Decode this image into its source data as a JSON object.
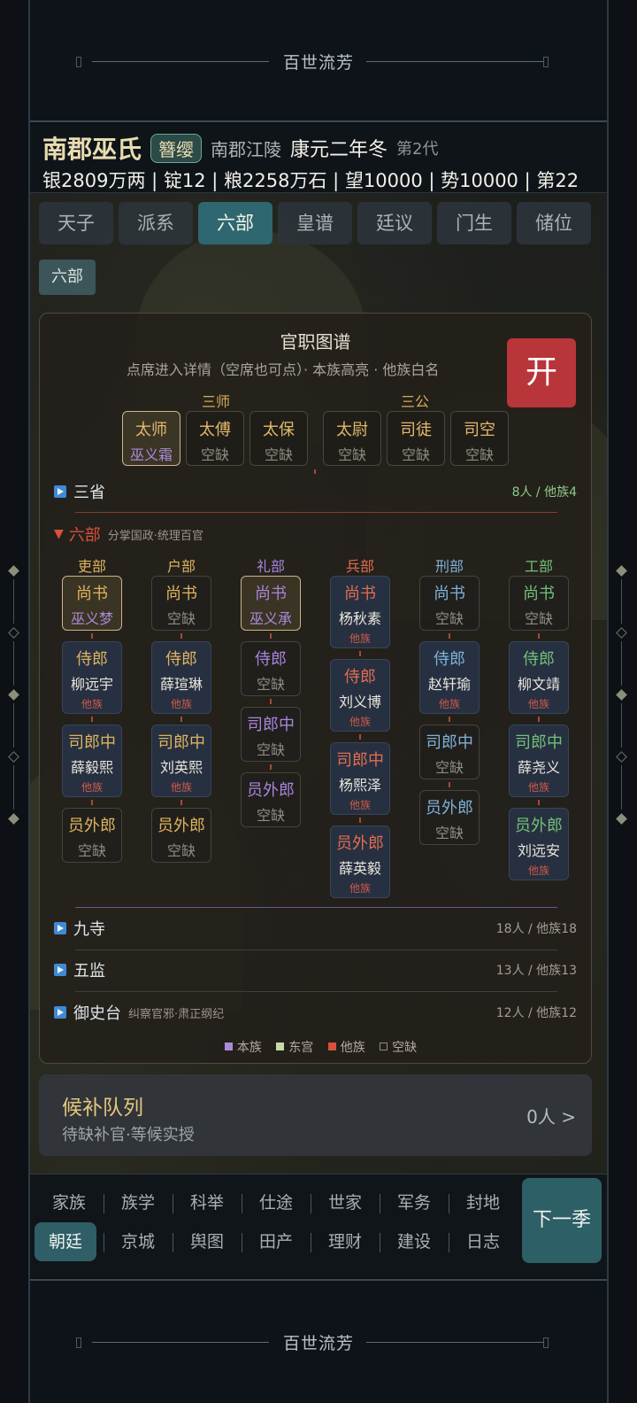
{
  "banner": {
    "title": "百世流芳"
  },
  "header": {
    "clan_name": "南郡巫氏",
    "badge": "簪缨",
    "place": "南郡江陵",
    "era": "康元二年冬",
    "generation": "第2代",
    "resources": "银2809万两 | 锭12 | 粮2258万石 | 望10000 | 势10000 | 第22"
  },
  "tabs": [
    "天子",
    "派系",
    "六部",
    "皇谱",
    "廷议",
    "门生",
    "储位"
  ],
  "sub_tab": "六部",
  "panel": {
    "title": "官职图谱",
    "subtitle": "点席进入详情（空席也可点）· 本族高亮 · 他族白名",
    "open_button": "开",
    "sanshi_label": "三师",
    "sangong_label": "三公",
    "sanshi": [
      {
        "title": "太师",
        "holder": "巫义霜"
      },
      {
        "title": "太傅",
        "holder": "空缺"
      },
      {
        "title": "太保",
        "holder": "空缺"
      }
    ],
    "sangong": [
      {
        "title": "太尉",
        "holder": "空缺"
      },
      {
        "title": "司徒",
        "holder": "空缺"
      },
      {
        "title": "司空",
        "holder": "空缺"
      }
    ],
    "sansheng": {
      "name": "三省",
      "stat": "8人 / 他族4"
    },
    "liubu": {
      "name": "六部",
      "note": "分掌国政·统理百官"
    },
    "depts": [
      {
        "name": "吏部",
        "color": "#e0b35e",
        "offices": [
          {
            "t": "尚书",
            "n": "巫义梦",
            "tag": "",
            "kind": "own"
          },
          {
            "t": "侍郎",
            "n": "柳远宇",
            "tag": "他族",
            "kind": "other"
          },
          {
            "t": "司郎中",
            "n": "薛毅熙",
            "tag": "他族",
            "kind": "other"
          },
          {
            "t": "员外郎",
            "n": "空缺",
            "tag": "",
            "kind": "empty"
          }
        ]
      },
      {
        "name": "户部",
        "color": "#e0b35e",
        "offices": [
          {
            "t": "尚书",
            "n": "空缺",
            "tag": "",
            "kind": "empty"
          },
          {
            "t": "侍郎",
            "n": "薛瑄琳",
            "tag": "他族",
            "kind": "other"
          },
          {
            "t": "司郎中",
            "n": "刘英熙",
            "tag": "他族",
            "kind": "other"
          },
          {
            "t": "员外郎",
            "n": "空缺",
            "tag": "",
            "kind": "empty"
          }
        ]
      },
      {
        "name": "礼部",
        "color": "#a985dc",
        "offices": [
          {
            "t": "尚书",
            "n": "巫义承",
            "tag": "",
            "kind": "own"
          },
          {
            "t": "侍郎",
            "n": "空缺",
            "tag": "",
            "kind": "empty"
          },
          {
            "t": "司郎中",
            "n": "空缺",
            "tag": "",
            "kind": "empty"
          },
          {
            "t": "员外郎",
            "n": "空缺",
            "tag": "",
            "kind": "empty"
          }
        ]
      },
      {
        "name": "兵部",
        "color": "#e16d50",
        "offices": [
          {
            "t": "尚书",
            "n": "杨秋素",
            "tag": "他族",
            "kind": "other"
          },
          {
            "t": "侍郎",
            "n": "刘义博",
            "tag": "他族",
            "kind": "other"
          },
          {
            "t": "司郎中",
            "n": "杨熙泽",
            "tag": "他族",
            "kind": "other"
          },
          {
            "t": "员外郎",
            "n": "薛英毅",
            "tag": "他族",
            "kind": "other"
          }
        ]
      },
      {
        "name": "刑部",
        "color": "#7fb1d9",
        "offices": [
          {
            "t": "尚书",
            "n": "空缺",
            "tag": "",
            "kind": "empty"
          },
          {
            "t": "侍郎",
            "n": "赵轩瑜",
            "tag": "他族",
            "kind": "other"
          },
          {
            "t": "司郎中",
            "n": "空缺",
            "tag": "",
            "kind": "empty"
          },
          {
            "t": "员外郎",
            "n": "空缺",
            "tag": "",
            "kind": "empty"
          }
        ]
      },
      {
        "name": "工部",
        "color": "#73c07a",
        "offices": [
          {
            "t": "尚书",
            "n": "空缺",
            "tag": "",
            "kind": "empty"
          },
          {
            "t": "侍郎",
            "n": "柳文靖",
            "tag": "他族",
            "kind": "other"
          },
          {
            "t": "司郎中",
            "n": "薛尧义",
            "tag": "他族",
            "kind": "other"
          },
          {
            "t": "员外郎",
            "n": "刘远安",
            "tag": "他族",
            "kind": "other"
          }
        ]
      }
    ],
    "jiusi": {
      "name": "九寺",
      "stat": "18人 / 他族18"
    },
    "wujian": {
      "name": "五监",
      "stat": "13人 / 他族13"
    },
    "yushitai": {
      "name": "御史台",
      "note": "纠察官邪·肃正纲纪",
      "stat": "12人 / 他族12"
    },
    "legend": [
      {
        "label": "本族",
        "color": "#a98bd8"
      },
      {
        "label": "东宫",
        "color": "#c8d8a8"
      },
      {
        "label": "他族",
        "color": "#d9503f"
      },
      {
        "label": "空缺",
        "color": "transparent"
      }
    ]
  },
  "queue": {
    "title": "候补队列",
    "subtitle": "待缺补官·等候实授",
    "count": "0人 >"
  },
  "nav": {
    "row1": [
      "家族",
      "族学",
      "科举",
      "仕途",
      "世家",
      "军务",
      "封地"
    ],
    "row2": [
      "朝廷",
      "京城",
      "舆图",
      "田产",
      "理财",
      "建设",
      "日志"
    ],
    "active": "朝廷",
    "next_button": "下一季"
  }
}
